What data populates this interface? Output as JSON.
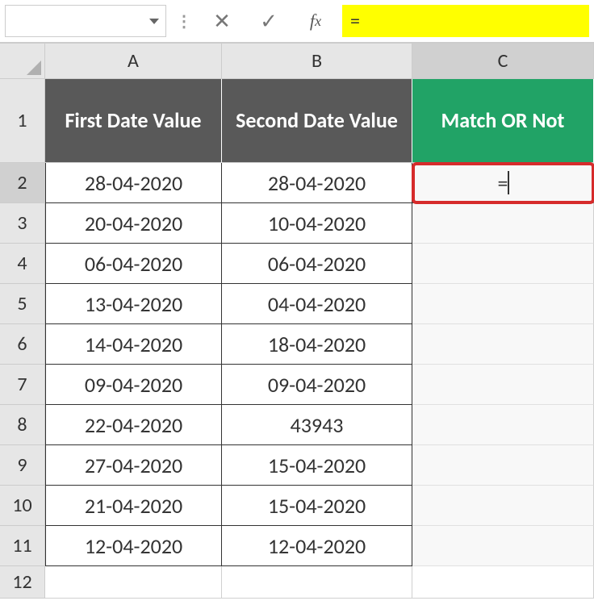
{
  "formula_bar": {
    "name_box_value": "",
    "formula_value": "="
  },
  "columns": [
    "A",
    "B",
    "C"
  ],
  "rows": [
    "1",
    "2",
    "3",
    "4",
    "5",
    "6",
    "7",
    "8",
    "9",
    "10",
    "11",
    "12"
  ],
  "headers": {
    "a": "First Date Value",
    "b": "Second Date Value",
    "c": "Match OR Not"
  },
  "data": [
    {
      "a": "28-04-2020",
      "b": "28-04-2020",
      "c": "="
    },
    {
      "a": "20-04-2020",
      "b": "10-04-2020",
      "c": ""
    },
    {
      "a": "06-04-2020",
      "b": "06-04-2020",
      "c": ""
    },
    {
      "a": "13-04-2020",
      "b": "04-04-2020",
      "c": ""
    },
    {
      "a": "14-04-2020",
      "b": "18-04-2020",
      "c": ""
    },
    {
      "a": "09-04-2020",
      "b": "09-04-2020",
      "c": ""
    },
    {
      "a": "22-04-2020",
      "b": "43943",
      "c": ""
    },
    {
      "a": "27-04-2020",
      "b": "15-04-2020",
      "c": ""
    },
    {
      "a": "21-04-2020",
      "b": "15-04-2020",
      "c": ""
    },
    {
      "a": "12-04-2020",
      "b": "12-04-2020",
      "c": ""
    }
  ],
  "active_cell": "C2"
}
